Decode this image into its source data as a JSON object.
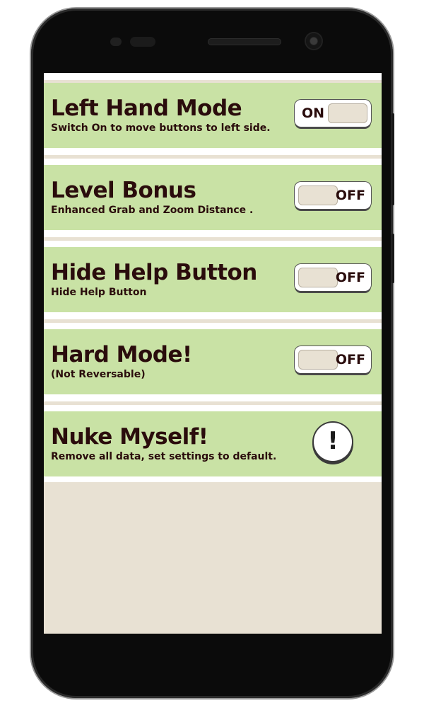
{
  "settings": {
    "left_hand_mode": {
      "title": "Left Hand Mode",
      "description": "Switch On to move buttons to left side.",
      "state_label": "ON"
    },
    "level_bonus": {
      "title": "Level Bonus",
      "description": "Enhanced Grab and Zoom Distance .",
      "state_label": "OFF"
    },
    "hide_help_button": {
      "title": "Hide Help Button",
      "description": "Hide Help Button",
      "state_label": "OFF"
    },
    "hard_mode": {
      "title": "Hard Mode!",
      "description": "(Not Reversable)",
      "state_label": "OFF"
    },
    "nuke_myself": {
      "title": "Nuke Myself!",
      "description": "Remove all data, set settings to default.",
      "button_glyph": "!"
    }
  },
  "icons": {
    "nuke": "exclamation-icon"
  },
  "colors": {
    "row_background": "#c9e2a5",
    "screen_background": "#e8e1d3",
    "text": "#2a0c0c",
    "toggle_track": "#ffffff",
    "toggle_knob": "#e8e1d3"
  }
}
